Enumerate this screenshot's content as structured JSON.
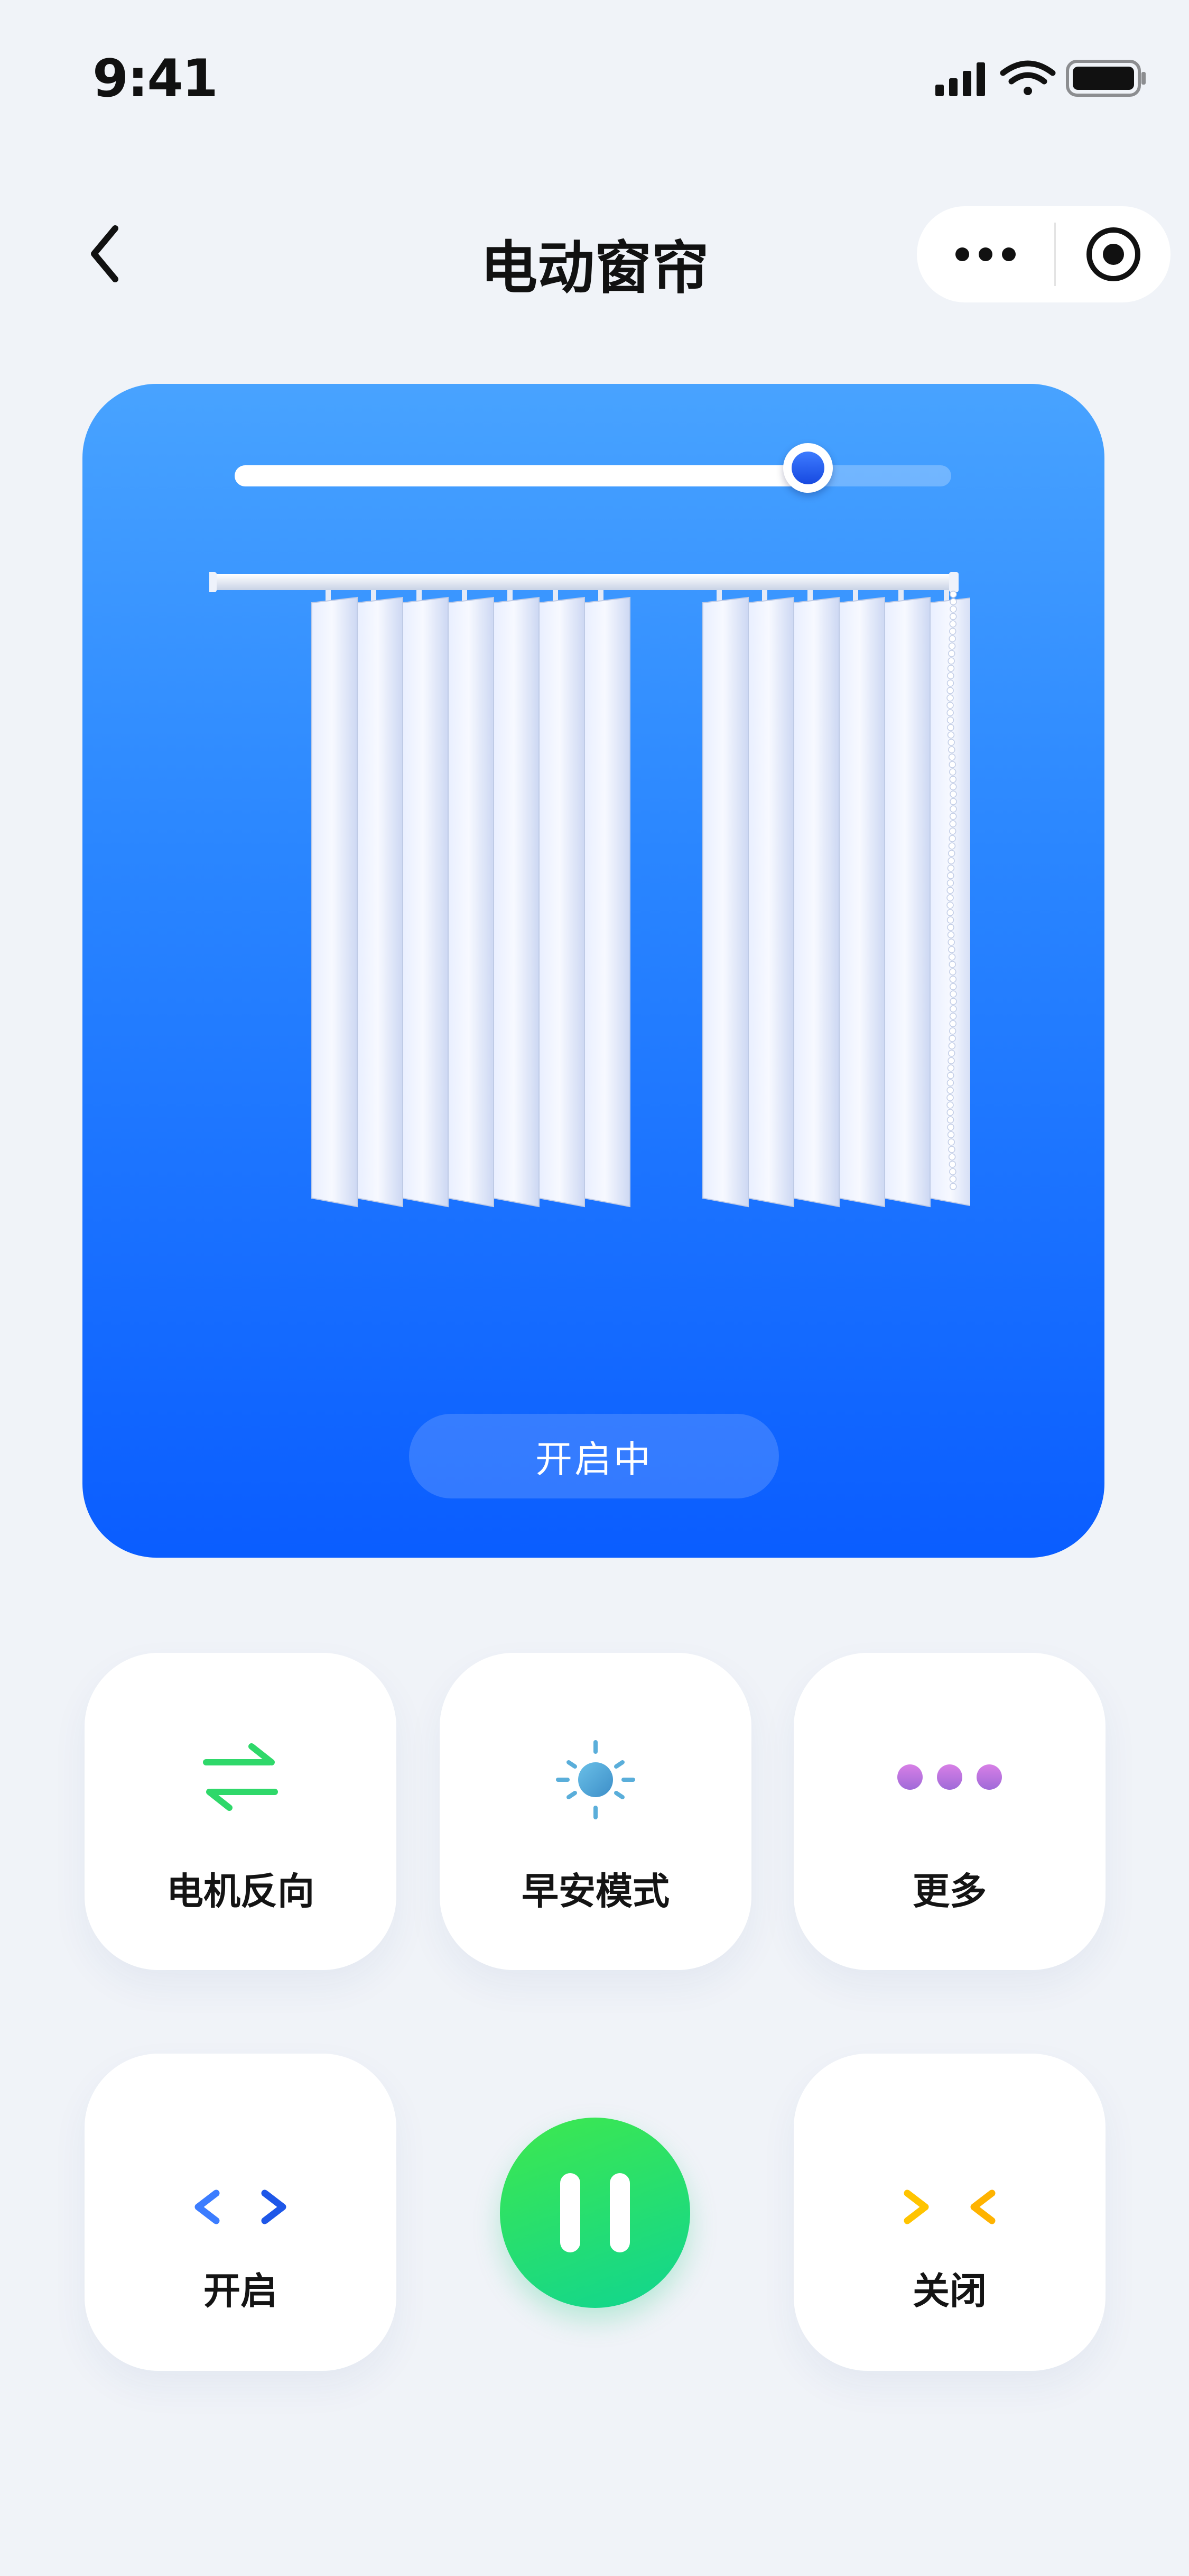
{
  "status_bar": {
    "time": "9:41"
  },
  "nav": {
    "title": "电动窗帘"
  },
  "hero": {
    "status_label": "开启中",
    "position_fraction": 0.8
  },
  "actions": {
    "reverse_label": "电机反向",
    "morning_label": "早安模式",
    "more_label": "更多",
    "open_label": "开启",
    "close_label": "关闭"
  },
  "icons": {
    "back": "chevron-left-icon",
    "more": "more-dots-icon",
    "target": "target-icon",
    "reverse": "swap-arrows-icon",
    "morning": "sun-icon",
    "more_tile": "three-dots-icon",
    "open": "open-chevrons-icon",
    "close": "close-chevrons-icon",
    "pause": "pause-icon"
  },
  "colors": {
    "accent_blue": "#0a5dff",
    "reverse_green": "#2fd86a",
    "sun_blue": "#5aaeda",
    "dots_purple": "#c878e0",
    "open_blue": "#2a6bff",
    "close_yellow": "#ffc400",
    "pause_green": "#1ddc7a"
  }
}
